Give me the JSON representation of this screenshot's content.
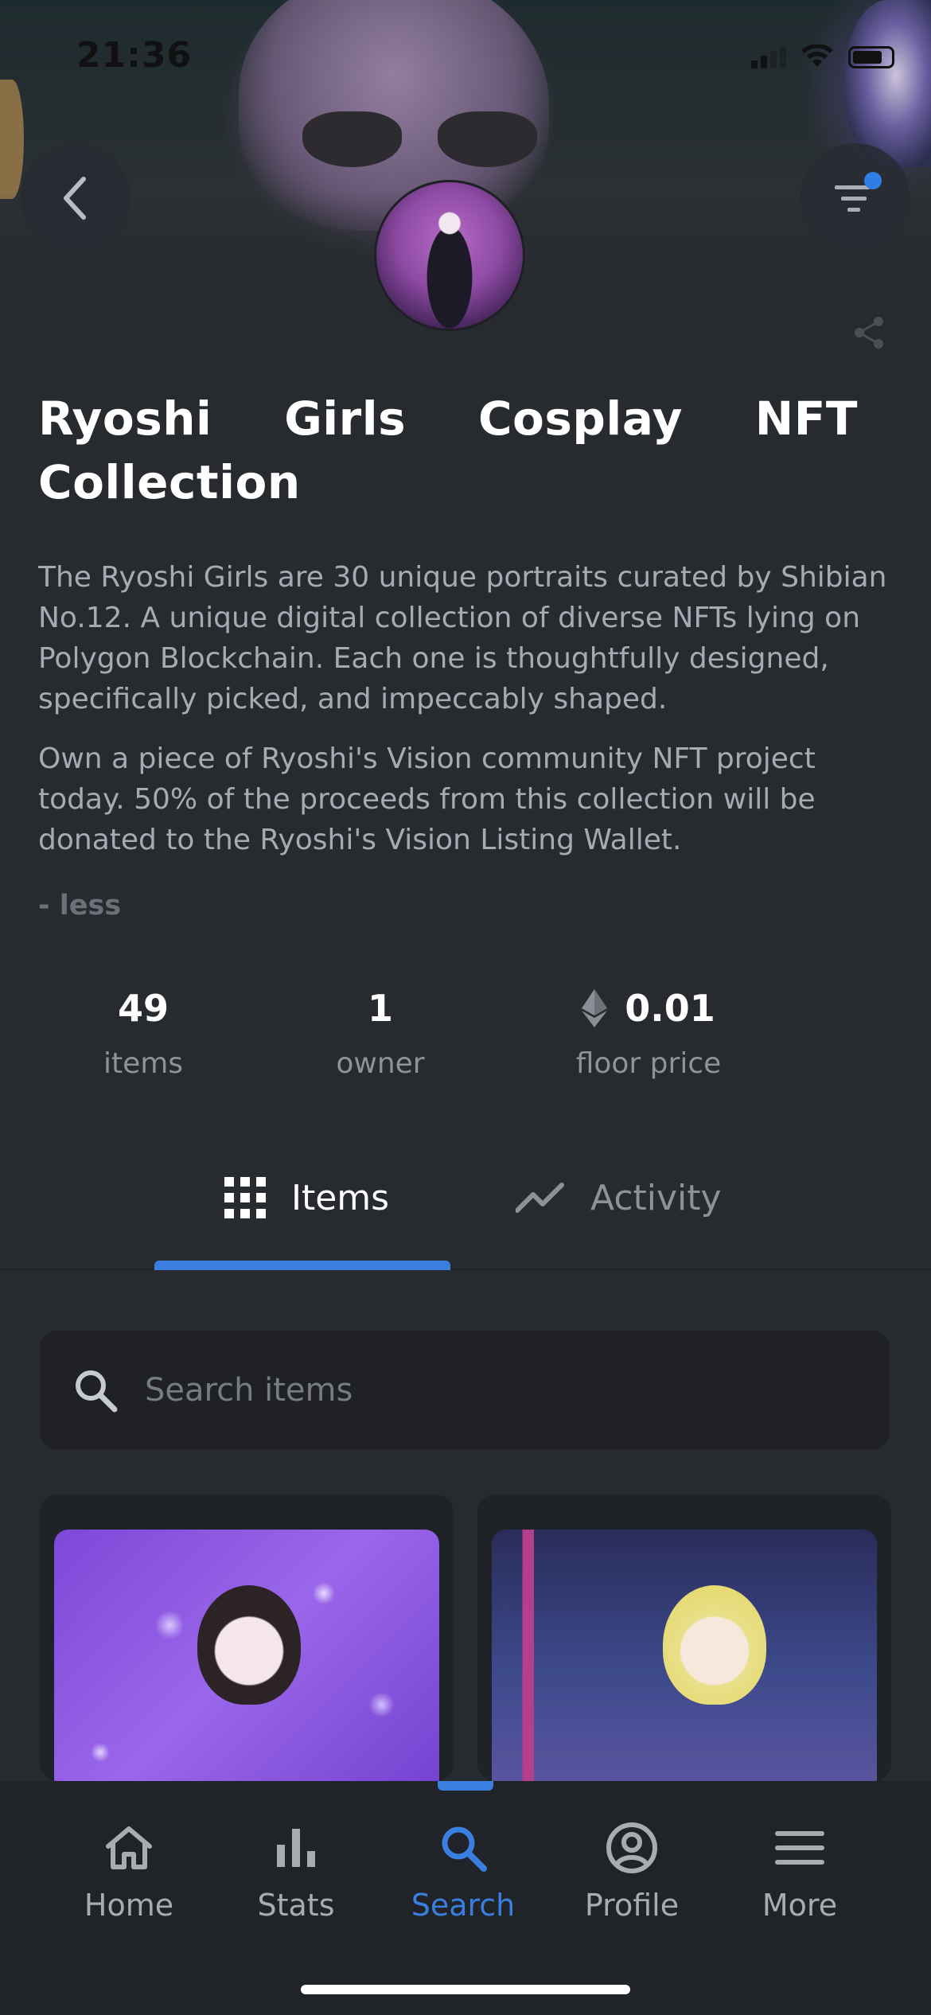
{
  "status_bar": {
    "time": "21:36"
  },
  "collection": {
    "title": "Ryoshi Girls Cosplay NFT Collection",
    "description_1": "The Ryoshi Girls are 30 unique portraits curated by Shibian No.12. A unique digital collection of diverse NFTs lying on Polygon Blockchain. Each one is thoughtfully designed, specifically picked, and impeccably shaped.",
    "description_2": "Own a piece of Ryoshi's Vision community NFT project today. 50% of the proceeds from this collection will be donated to the Ryoshi's Vision Listing Wallet.",
    "toggle_label": "- less"
  },
  "stats": {
    "items_value": "49",
    "items_label": "items",
    "owner_value": "1",
    "owner_label": "owner",
    "floor_value": "0.01",
    "floor_label": "floor price",
    "floor_icon": "ethereum-icon"
  },
  "tabs": {
    "items_label": "Items",
    "activity_label": "Activity",
    "active": "Items"
  },
  "search": {
    "placeholder": "Search items",
    "value": ""
  },
  "bottom_nav": {
    "home": "Home",
    "stats": "Stats",
    "search": "Search",
    "profile": "Profile",
    "more": "More",
    "active": "Search"
  },
  "colors": {
    "background": "#272a2f",
    "accent": "#3a7fe0",
    "muted_text": "#a6aab2"
  }
}
